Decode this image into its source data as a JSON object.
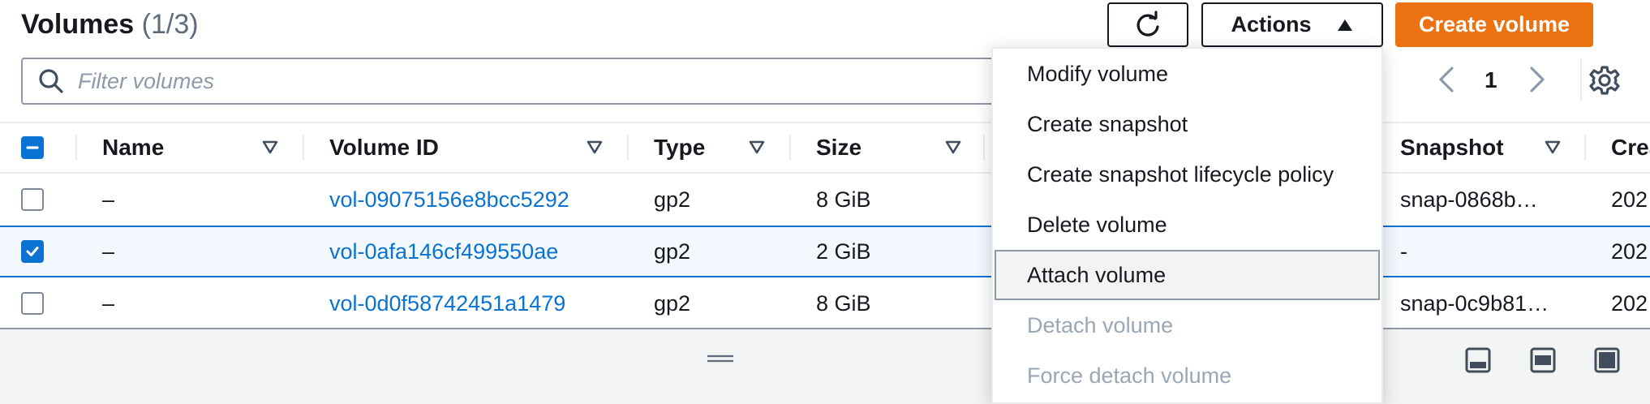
{
  "header": {
    "title": "Volumes",
    "count": "(1/3)",
    "actions_label": "Actions",
    "create_label": "Create volume"
  },
  "filter": {
    "placeholder": "Filter volumes"
  },
  "pagination": {
    "current_page": "1"
  },
  "table": {
    "columns": [
      "Name",
      "Volume ID",
      "Type",
      "Size",
      "Snapshot",
      "Crea"
    ],
    "rows": [
      {
        "selected": false,
        "name": "–",
        "volume_id": "vol-09075156e8bcc5292",
        "type": "gp2",
        "size": "8 GiB",
        "snapshot": "snap-0868b…",
        "created": "202"
      },
      {
        "selected": true,
        "name": "–",
        "volume_id": "vol-0afa146cf499550ae",
        "type": "gp2",
        "size": "2 GiB",
        "snapshot": "-",
        "created": "202"
      },
      {
        "selected": false,
        "name": "–",
        "volume_id": "vol-0d0f58742451a1479",
        "type": "gp2",
        "size": "8 GiB",
        "snapshot": "snap-0c9b81…",
        "created": "202"
      }
    ]
  },
  "actions_menu": {
    "items": [
      {
        "label": "Modify volume",
        "state": "enabled"
      },
      {
        "label": "Create snapshot",
        "state": "enabled"
      },
      {
        "label": "Create snapshot lifecycle policy",
        "state": "enabled"
      },
      {
        "label": "Delete volume",
        "state": "enabled"
      },
      {
        "label": "Attach volume",
        "state": "highlighted"
      },
      {
        "label": "Detach volume",
        "state": "disabled"
      },
      {
        "label": "Force detach volume",
        "state": "disabled"
      }
    ]
  },
  "colors": {
    "primary_button": "#ec7211",
    "link": "#0972d3",
    "selected_row_bg": "#f2f8fd",
    "disabled_text": "#9ba7b6"
  },
  "icons": {
    "refresh": "refresh-icon",
    "actions_caret": "caret-up-icon",
    "search": "search-icon",
    "prev": "chevron-left-icon",
    "next": "chevron-right-icon",
    "settings": "gear-icon",
    "sort": "sort-caret-icon",
    "drag": "drag-handle-icon",
    "panel_bottom": "panel-bottom-icon",
    "panel_side": "panel-side-icon",
    "panel_full": "panel-full-icon"
  }
}
